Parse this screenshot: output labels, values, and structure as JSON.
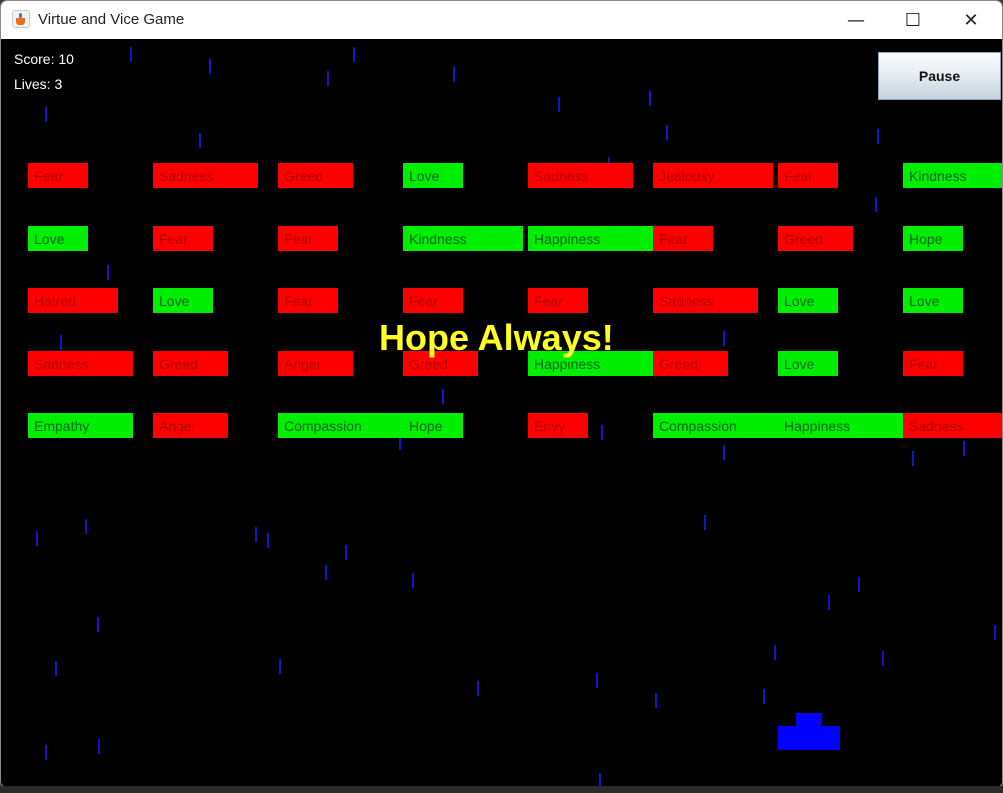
{
  "window": {
    "title": "Virtue and Vice Game",
    "minimize_glyph": "—",
    "maximize_glyph": "☐",
    "close_glyph": "✕"
  },
  "hud": {
    "score": "Score: 10",
    "lives": "Lives: 3",
    "pause_label": "Pause"
  },
  "message": "Hope Always!",
  "colors": {
    "background": "#000000",
    "vice": "#ff0000",
    "virtue": "#00ee00",
    "message": "#ffff22",
    "paddle": "#0000ff",
    "rain": "#1414c8"
  },
  "bricks": [
    {
      "label": "Fear",
      "kind": "vice"
    },
    {
      "label": "Sadness",
      "kind": "vice"
    },
    {
      "label": "Greed",
      "kind": "vice"
    },
    {
      "label": "Love",
      "kind": "virtue"
    },
    {
      "label": "Sadness",
      "kind": "vice"
    },
    {
      "label": "Jealousy",
      "kind": "vice"
    },
    {
      "label": "Fear",
      "kind": "vice"
    },
    {
      "label": "Kindness",
      "kind": "virtue"
    },
    {
      "label": "Love",
      "kind": "virtue"
    },
    {
      "label": "Fear",
      "kind": "vice"
    },
    {
      "label": "Fear",
      "kind": "vice"
    },
    {
      "label": "Kindness",
      "kind": "virtue"
    },
    {
      "label": "Happiness",
      "kind": "virtue"
    },
    {
      "label": "Fear",
      "kind": "vice"
    },
    {
      "label": "Greed",
      "kind": "vice"
    },
    {
      "label": "Hope",
      "kind": "virtue"
    },
    {
      "label": "Hatred",
      "kind": "vice"
    },
    {
      "label": "Love",
      "kind": "virtue"
    },
    {
      "label": "Fear",
      "kind": "vice"
    },
    {
      "label": "Fear",
      "kind": "vice"
    },
    {
      "label": "Fear",
      "kind": "vice"
    },
    {
      "label": "Sadness",
      "kind": "vice"
    },
    {
      "label": "Love",
      "kind": "virtue"
    },
    {
      "label": "Love",
      "kind": "virtue"
    },
    {
      "label": "Sadness",
      "kind": "vice"
    },
    {
      "label": "Greed",
      "kind": "vice"
    },
    {
      "label": "Anger",
      "kind": "vice"
    },
    {
      "label": "Greed",
      "kind": "vice"
    },
    {
      "label": "Happiness",
      "kind": "virtue"
    },
    {
      "label": "Greed",
      "kind": "vice"
    },
    {
      "label": "Love",
      "kind": "virtue"
    },
    {
      "label": "Fear",
      "kind": "vice"
    },
    {
      "label": "Empathy",
      "kind": "virtue"
    },
    {
      "label": "Anger",
      "kind": "vice"
    },
    {
      "label": "Compassion",
      "kind": "virtue"
    },
    {
      "label": "Hope",
      "kind": "virtue"
    },
    {
      "label": "Envy",
      "kind": "vice"
    },
    {
      "label": "Compassion",
      "kind": "virtue"
    },
    {
      "label": "Happiness",
      "kind": "virtue"
    },
    {
      "label": "Sadness",
      "kind": "vice"
    }
  ]
}
